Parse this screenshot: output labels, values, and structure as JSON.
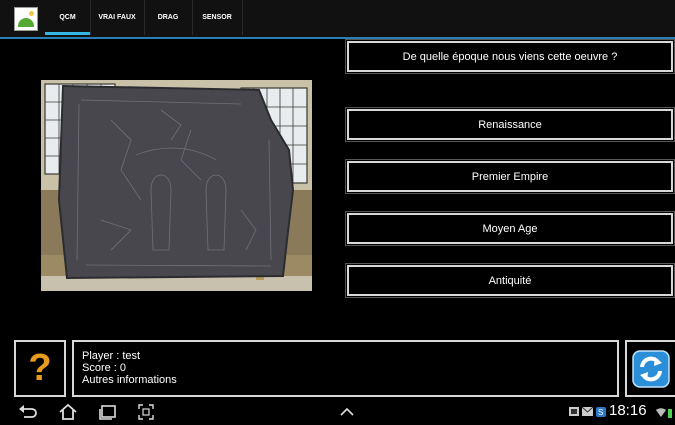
{
  "tabs": [
    {
      "label": "QCM",
      "active": true
    },
    {
      "label": "VRAI FAUX",
      "active": false
    },
    {
      "label": "DRAG",
      "active": false
    },
    {
      "label": "SENSOR",
      "active": false
    }
  ],
  "quiz": {
    "question": "De quelle époque nous viens cette oeuvre ?",
    "answers": [
      "Renaissance",
      "Premier Empire",
      "Moyen Age",
      "Antiquité"
    ]
  },
  "player": {
    "name_line": "Player : test",
    "score_line": "Score : 0",
    "info_line": "Autres informations"
  },
  "help_symbol": "?",
  "system": {
    "time": "18:16"
  },
  "colors": {
    "tab_indicator": "#33b5e5",
    "help": "#e89a1e",
    "refresh": "#2a8fd8"
  }
}
